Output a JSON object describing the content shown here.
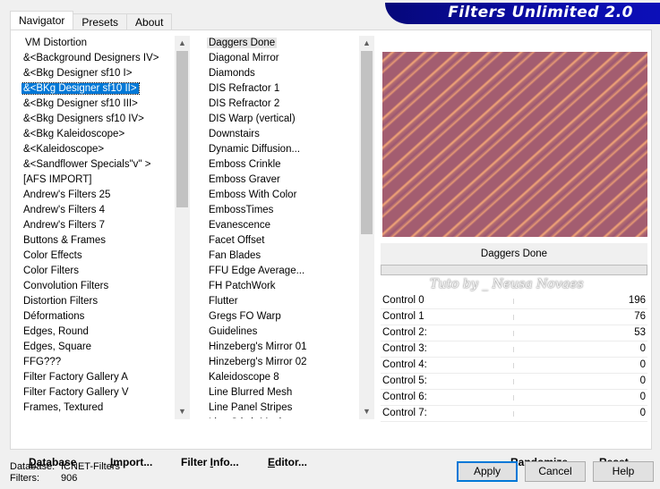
{
  "tabs": [
    {
      "label": "Navigator",
      "active": true
    },
    {
      "label": "Presets",
      "active": false
    },
    {
      "label": "About",
      "active": false
    }
  ],
  "banner_title": "Filters Unlimited 2.0",
  "categories": [
    "VM Distortion",
    "&<Background Designers IV>",
    "&<Bkg Designer sf10 I>",
    "&<BKg Designer sf10 II>",
    "&<Bkg Designer sf10 III>",
    "&<Bkg Designers sf10 IV>",
    "&<Bkg Kaleidoscope>",
    "&<Kaleidoscope>",
    "&<Sandflower Specials\"v\" >",
    "[AFS IMPORT]",
    "Andrew's Filters 25",
    "Andrew's Filters 4",
    "Andrew's Filters 7",
    "Buttons & Frames",
    "Color Effects",
    "Color Filters",
    "Convolution Filters",
    "Distortion Filters",
    "Déformations",
    "Edges, Round",
    "Edges, Square",
    "FFG???",
    "Filter Factory Gallery A",
    "Filter Factory Gallery V",
    "Frames, Textured"
  ],
  "selected_category_index": 3,
  "filters": [
    {
      "name": "Daggers Done",
      "group": false
    },
    {
      "name": "Diagonal Mirror",
      "group": false
    },
    {
      "name": "Diamonds",
      "group": false
    },
    {
      "name": "DIS Refractor 1",
      "group": false
    },
    {
      "name": "DIS Refractor 2",
      "group": true
    },
    {
      "name": "DIS Warp (vertical)",
      "group": false
    },
    {
      "name": "Downstairs",
      "group": false
    },
    {
      "name": "Dynamic Diffusion...",
      "group": false
    },
    {
      "name": "Emboss Crinkle",
      "group": false
    },
    {
      "name": "Emboss Graver",
      "group": false
    },
    {
      "name": "Emboss With Color",
      "group": false
    },
    {
      "name": "EmbossTimes",
      "group": false
    },
    {
      "name": "Evanescence",
      "group": false
    },
    {
      "name": "Facet Offset",
      "group": false
    },
    {
      "name": "Fan Blades",
      "group": false
    },
    {
      "name": "FFU Edge Average...",
      "group": false
    },
    {
      "name": "FH PatchWork",
      "group": false
    },
    {
      "name": "Flutter",
      "group": true
    },
    {
      "name": "Gregs FO Warp",
      "group": false
    },
    {
      "name": "Guidelines",
      "group": true
    },
    {
      "name": "Hinzeberg's Mirror 01",
      "group": false
    },
    {
      "name": "Hinzeberg's Mirror 02",
      "group": false
    },
    {
      "name": "Kaleidoscope 8",
      "group": false
    },
    {
      "name": "Line Blurred Mesh",
      "group": false
    },
    {
      "name": "Line Panel Stripes",
      "group": false
    },
    {
      "name": "Line Stitch Mesh",
      "group": false
    }
  ],
  "selected_filter_index": 0,
  "selected_filter_name": "Daggers Done",
  "watermark_text": "Tuto by _ Neusa Novaes",
  "controls": [
    {
      "label": "Control 0",
      "value": "196"
    },
    {
      "label": "Control  1",
      "value": "76"
    },
    {
      "label": "Control 2:",
      "value": "53"
    },
    {
      "label": "Control 3:",
      "value": "0"
    },
    {
      "label": "Control 4:",
      "value": "0"
    },
    {
      "label": "Control 5:",
      "value": "0"
    },
    {
      "label": "Control 6:",
      "value": "0"
    },
    {
      "label": "Control 7:",
      "value": "0"
    }
  ],
  "panel_buttons": {
    "database": {
      "u": "D",
      "rest": "atabase"
    },
    "import": {
      "u": "I",
      "rest": "mport..."
    },
    "filter_info": {
      "pre": "Filter ",
      "u": "I",
      "rest": "nfo..."
    },
    "editor": {
      "u": "E",
      "rest": "ditor..."
    },
    "randomize": "Randomize",
    "reset": "Reset"
  },
  "status": {
    "database_label": "Database:",
    "database_value": "ICNET-Filters",
    "filters_label": "Filters:",
    "filters_value": "906"
  },
  "dialog_buttons": {
    "apply": "Apply",
    "cancel": "Cancel",
    "help": "Help"
  },
  "colors": {
    "accent": "#0078d7",
    "banner": "#0a0ca8"
  }
}
